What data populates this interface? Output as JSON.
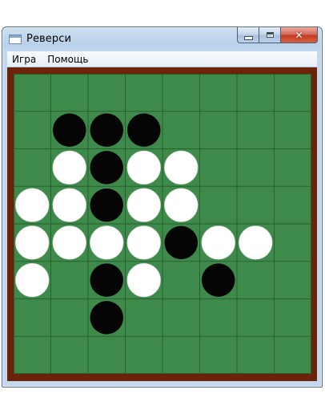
{
  "window": {
    "title": "Реверси"
  },
  "menu": [
    {
      "label": "Игра"
    },
    {
      "label": "Помощь"
    }
  ],
  "caption_buttons": {
    "close_glyph": "✕"
  },
  "colors": {
    "board_felt": "#3d8a4a",
    "grid_line": "#28602f",
    "frame": "#6b2309",
    "black_disc": "#050505",
    "white_disc": "#ffffff"
  },
  "board": {
    "size": 8,
    "grid": [
      [
        "",
        "",
        "",
        "",
        "",
        "",
        "",
        ""
      ],
      [
        "",
        "B",
        "B",
        "B",
        "",
        "",
        "",
        ""
      ],
      [
        "",
        "W",
        "B",
        "W",
        "W",
        "",
        "",
        ""
      ],
      [
        "W",
        "W",
        "B",
        "W",
        "W",
        "",
        "",
        ""
      ],
      [
        "W",
        "W",
        "W",
        "W",
        "B",
        "W",
        "W",
        ""
      ],
      [
        "W",
        "",
        "B",
        "W",
        "",
        "B",
        "",
        ""
      ],
      [
        "",
        "",
        "B",
        "",
        "",
        "",
        "",
        ""
      ],
      [
        "",
        "",
        "",
        "",
        "",
        "",
        "",
        ""
      ]
    ]
  }
}
